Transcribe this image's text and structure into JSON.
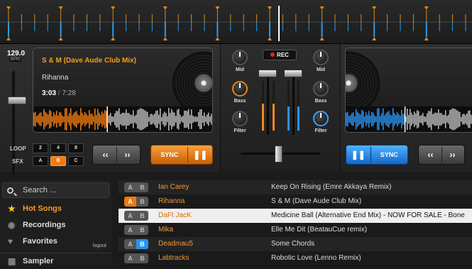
{
  "deck_a": {
    "bpm": "129.0",
    "bpm_label": "BPM",
    "title": "S & M (Dave Aude Club Mix)",
    "artist": "Rihanna",
    "elapsed": "3:03",
    "separator": "/",
    "total": "7:28",
    "loop_label": "LOOP",
    "sfx_label": "SFX",
    "loop_pads": [
      "2",
      "4",
      "8"
    ],
    "sfx_pads": [
      "A",
      "B",
      "C"
    ],
    "sfx_active": "B",
    "rewind_icon": "double-chevron-left",
    "forward_icon": "double-chevron-right",
    "sync_label": "SYNC",
    "pause_icon": "pause",
    "accent": "#ef7a12",
    "waveform_played_fraction": 0.41
  },
  "mixer": {
    "rec_label": "REC",
    "left_knobs": [
      "Mid",
      "Bass",
      "Filter"
    ],
    "right_knobs": [
      "Mid",
      "Bass",
      "Filter"
    ]
  },
  "deck_b": {
    "sync_label": "SYNC",
    "pause_icon": "pause",
    "rewind_icon": "double-chevron-left",
    "forward_icon": "double-chevron-right",
    "accent": "#2b92ee"
  },
  "sidebar": {
    "search_placeholder": "Search ...",
    "items": [
      {
        "label": "Hot Songs",
        "icon": "star-icon"
      },
      {
        "label": "Recordings",
        "icon": "record-icon"
      },
      {
        "label": "Favorites",
        "icon": "heart-icon"
      },
      {
        "label": "Sampler",
        "icon": "grid-icon"
      }
    ],
    "logout": "logout"
  },
  "tracks": [
    {
      "artist": "Ian Carey",
      "song": "Keep On Rising (Emre Akkaya Remix)",
      "deck": ""
    },
    {
      "artist": "Rihanna",
      "song": "S & M (Dave Aude Club Mix)",
      "deck": "A"
    },
    {
      "artist": "DaFt JacK",
      "song": "Medicine Ball (Alternative End Mix) - NOW FOR SALE - Bone",
      "deck": ""
    },
    {
      "artist": "Mika",
      "song": "Elle Me Dit (BeatauCue remix)",
      "deck": ""
    },
    {
      "artist": "Deadmau5",
      "song": "Some Chords",
      "deck": "B"
    },
    {
      "artist": "Labtracks",
      "song": "Robotic Love (Lenno Remix)",
      "deck": ""
    }
  ],
  "ab_labels": [
    "A",
    "B"
  ]
}
